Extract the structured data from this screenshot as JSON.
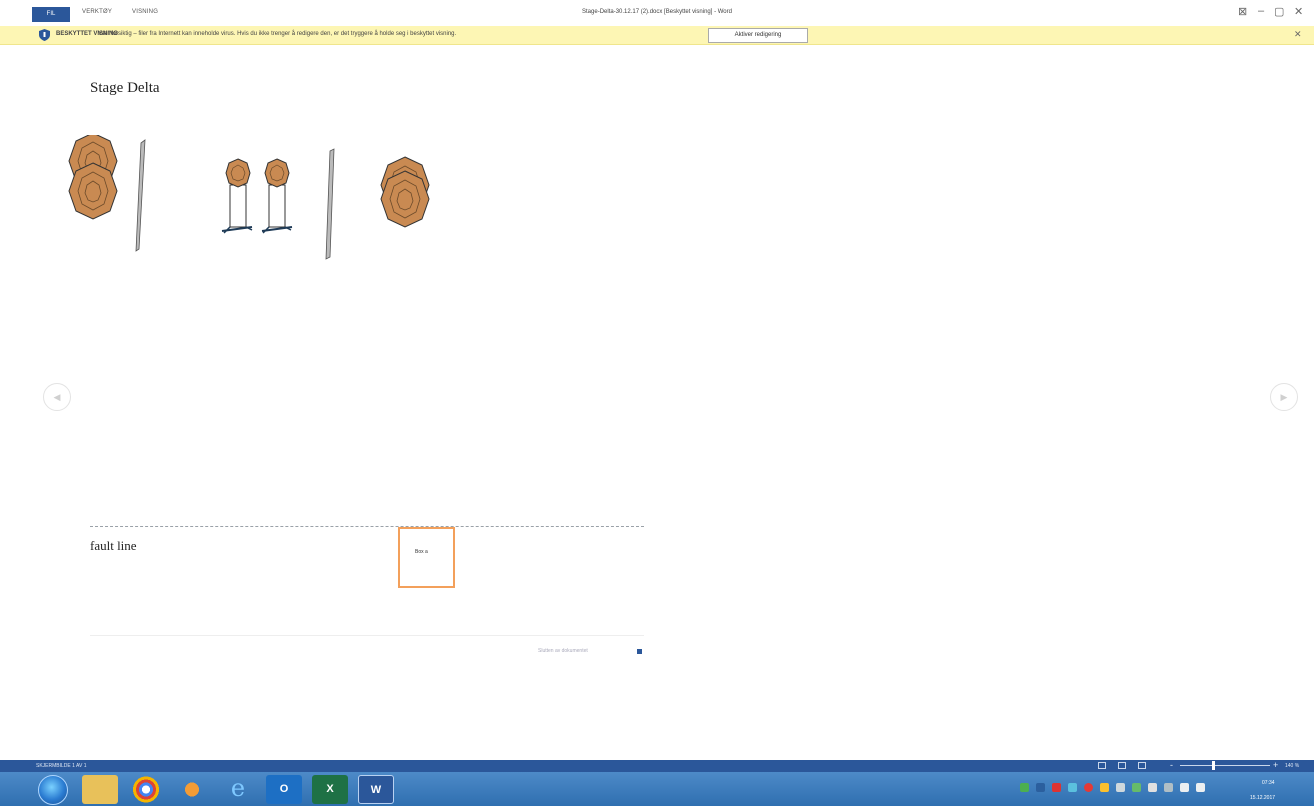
{
  "window": {
    "tabs": [
      "FIL",
      "VERKTØY",
      "VISNING"
    ],
    "title": "Stage-Delta-30.12.17 (2).docx [Beskyttet visning] - Word",
    "controls": [
      "⊠",
      "–",
      "▢",
      "✕"
    ]
  },
  "protected_view": {
    "title": "BESKYTTET VISNING",
    "message": "Vær forsiktig – filer fra Internett kan inneholde virus. Hvis du ikke trenger å redigere den, er det tryggere å holde seg i beskyttet visning.",
    "button": "Aktiver redigering",
    "close": "✕",
    "icon": "shield-icon"
  },
  "document": {
    "heading": "Stage Delta",
    "fault_line": "fault line",
    "box_label": "Box a",
    "end_text": "Slutten av dokumentet",
    "nav_prev": "◀",
    "nav_next": "▶"
  },
  "status": {
    "page": "SKJERMBILDE 1 AV 1",
    "zoom": "140 %",
    "zoom_level_percent": 140,
    "zoom_minus": "-",
    "zoom_plus": "+"
  },
  "taskbar": {
    "apps": [
      "file-explorer-icon",
      "chrome-icon",
      "media-player-icon",
      "internet-explorer-icon",
      "outlook-icon",
      "excel-icon",
      "word-icon"
    ],
    "app_labels": [
      "",
      "",
      "",
      "e",
      "O",
      "X",
      "W"
    ],
    "time": "07:34",
    "date": "15.12.2017"
  },
  "colors": {
    "accent": "#2b579a",
    "protected_bar": "#fdf6b4",
    "target_fill": "#c98a52",
    "box_border": "#f3a05b"
  }
}
